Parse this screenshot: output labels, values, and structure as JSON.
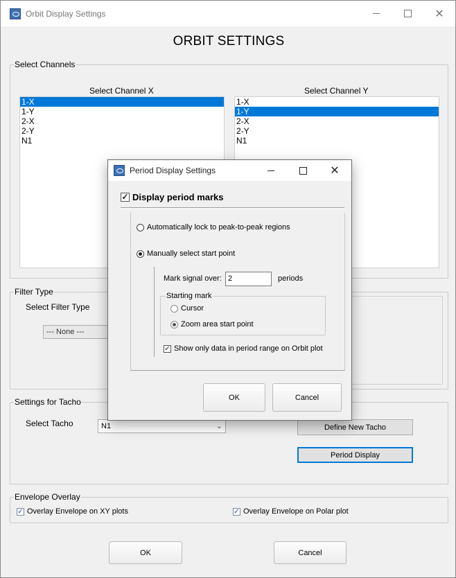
{
  "main_window": {
    "title": "Orbit Display Settings",
    "heading": "ORBIT SETTINGS",
    "select_channels": {
      "legend": "Select Channels",
      "x_label": "Select Channel X",
      "y_label": "Select Channel Y",
      "x_items": [
        "1-X",
        "1-Y",
        "2-X",
        "2-Y",
        "N1"
      ],
      "x_selected": 0,
      "y_items": [
        "1-X",
        "1-Y",
        "2-X",
        "2-Y",
        "N1"
      ],
      "y_selected": 1
    },
    "filter_type": {
      "legend": "Filter Type",
      "select_label": "Select Filter Type",
      "combo_value": "--- None ---"
    },
    "tacho": {
      "legend": "Settings for Tacho",
      "select_label": "Select Tacho",
      "combo_value": "N1",
      "define_button": "Define New Tacho",
      "period_button": "Period Display"
    },
    "envelope": {
      "legend": "Envelope Overlay",
      "xy_label": "Overlay Envelope on XY plots",
      "xy_checked": true,
      "polar_label": "Overlay Envelope on Polar plot",
      "polar_checked": true
    },
    "ok_button": "OK",
    "cancel_button": "Cancel"
  },
  "dialog": {
    "title": "Period Display Settings",
    "display_marks_label": "Display period marks",
    "display_marks_checked": true,
    "auto_lock_label": "Automatically lock to peak-to-peak regions",
    "manual_label": "Manually select start point",
    "mode_selected": "manual",
    "mark_signal_label": "Mark signal over:",
    "mark_signal_value": "2",
    "periods_label": "periods",
    "starting_mark": {
      "legend": "Starting mark",
      "cursor_label": "Cursor",
      "zoom_label": "Zoom area start point",
      "selected": "zoom"
    },
    "show_only_label": "Show only data in period range on Orbit plot",
    "show_only_checked": true,
    "ok_button": "OK",
    "cancel_button": "Cancel"
  },
  "icons": {
    "checkmark": "✓",
    "close": "✕",
    "chevron_down": "⌄"
  }
}
